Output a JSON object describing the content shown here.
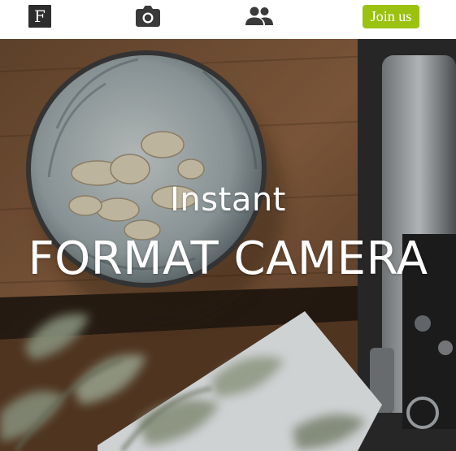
{
  "nav": {
    "logo_letter": "F",
    "join_label": "Join us",
    "join_color": "#9cc211",
    "icons": [
      "logo-icon",
      "camera-icon",
      "people-icon"
    ]
  },
  "hero": {
    "subtitle": "Instant",
    "title": "FORMAT CAMERA"
  }
}
